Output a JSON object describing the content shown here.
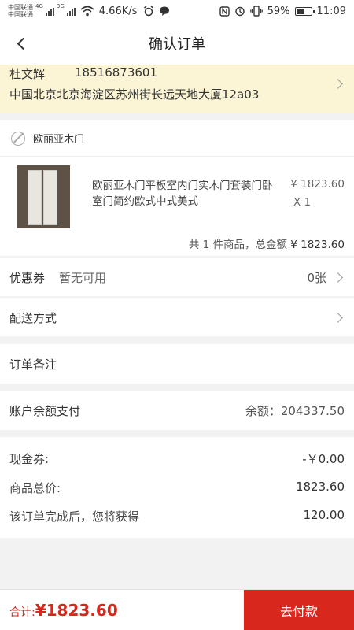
{
  "status_bar": {
    "carrier1": "中国联通",
    "carrier2": "中国联通",
    "net1": "4G",
    "net2": "3G",
    "speed": "4.66K/s",
    "battery": "59%",
    "battery_level": 0.59,
    "time": "11:09"
  },
  "nav": {
    "title": "确认订单"
  },
  "address": {
    "name": "杜文辉",
    "phone": "18516873601",
    "detail": "中国北京北京海淀区苏州街长远天地大厦12a03"
  },
  "shop": {
    "name": "欧丽亚木门",
    "product": {
      "title": "欧丽亚木门平板室内门实木门套装门卧室门简约欧式中式美式",
      "price": "¥ 1823.60",
      "qty": "X 1"
    },
    "summary_prefix": "共 1 件商品，总金额",
    "summary_total": "¥ 1823.60"
  },
  "coupon": {
    "label": "优惠券",
    "status": "暂无可用",
    "count": "0张"
  },
  "delivery": {
    "label": "配送方式"
  },
  "remark": {
    "label": "订单备注"
  },
  "balance": {
    "label": "账户余额支付",
    "value": "余额：204337.50"
  },
  "summary": {
    "cash_label": "现金券:",
    "cash_value": "-￥0.00",
    "goods_label": "商品总价:",
    "goods_value": "1823.60",
    "reward_label": "该订单完成后，您将获得",
    "reward_value": "120.00"
  },
  "footer": {
    "total_label": "合计:",
    "total_amount": "¥1823.60",
    "pay_label": "去付款",
    "accent": "#d8281d"
  }
}
